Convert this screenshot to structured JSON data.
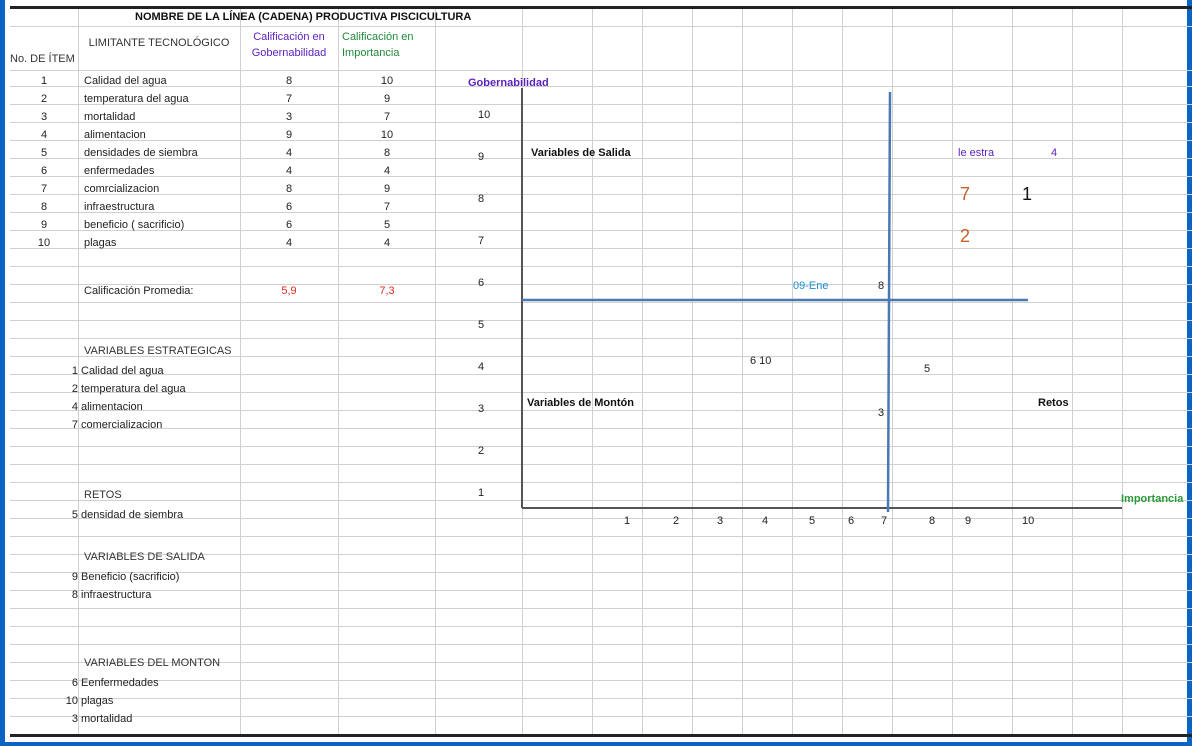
{
  "title": "NOMBRE DE LA LÍNEA (CADENA) PRODUCTIVA   PISCICULTURA",
  "headers": {
    "item": "No. DE ÍTEM",
    "limitante": "LIMITANTE TECNOLÓGICO",
    "gob1": "Calificación en",
    "gob2": "Gobernabilidad",
    "imp1": "Calificación en",
    "imp2": "Importancia"
  },
  "rows": [
    {
      "n": "1",
      "name": "Calidad del agua",
      "gob": "8",
      "imp": "10"
    },
    {
      "n": "2",
      "name": "temperatura del agua",
      "gob": "7",
      "imp": "9"
    },
    {
      "n": "3",
      "name": "mortalidad",
      "gob": "3",
      "imp": "7"
    },
    {
      "n": "4",
      "name": "alimentacion",
      "gob": "9",
      "imp": "10"
    },
    {
      "n": "5",
      "name": "densidades  de  siembra",
      "gob": "4",
      "imp": "8"
    },
    {
      "n": "6",
      "name": "enfermedades",
      "gob": "4",
      "imp": "4"
    },
    {
      "n": "7",
      "name": "comrcializacion",
      "gob": "8",
      "imp": "9"
    },
    {
      "n": "8",
      "name": "infraestructura",
      "gob": "6",
      "imp": "7"
    },
    {
      "n": "9",
      "name": "beneficio  ( sacrificio)",
      "gob": "6",
      "imp": "5"
    },
    {
      "n": "10",
      "name": "plagas",
      "gob": "4",
      "imp": "4"
    }
  ],
  "promedio": {
    "label": "Calificación Promedia:",
    "gob": "5,9",
    "imp": "7,3"
  },
  "sections": [
    {
      "title": "VARIABLES  ESTRATEGICAS",
      "items": [
        {
          "n": "1",
          "name": "Calidad del  agua"
        },
        {
          "n": "2",
          "name": "temperatura del agua"
        },
        {
          "n": "4",
          "name": "alimentacion"
        },
        {
          "n": "7",
          "name": "comercializacion"
        }
      ]
    },
    {
      "title": "RETOS",
      "items": [
        {
          "n": "5",
          "name": "densidad de siembra"
        }
      ]
    },
    {
      "title": "VARIABLES  DE SALIDA",
      "items": [
        {
          "n": "9",
          "name": "Beneficio (sacrificio)"
        },
        {
          "n": "8",
          "name": "infraestructura"
        }
      ]
    },
    {
      "title": "VARIABLES  DEL MONTON",
      "items": [
        {
          "n": "6",
          "name": "Eenfermedades"
        },
        {
          "n": "10",
          "name": "plagas"
        },
        {
          "n": "3",
          "name": "mortalidad"
        }
      ]
    }
  ],
  "chart": {
    "ylabel": "Gobernabilidad",
    "xlabel": "Importancia",
    "yticks": [
      "10",
      "9",
      "8",
      "7",
      "6",
      "5",
      "4",
      "3",
      "2",
      "1"
    ],
    "xticks": [
      "1",
      "2",
      "3",
      "4",
      "5",
      "6",
      "7",
      "8",
      "9",
      "10"
    ],
    "q_salida": "Variables de Salida",
    "q_monton": "Variables de Montón",
    "q_retos": "Retos",
    "q_estra": "le estra",
    "q_estra_n": "4",
    "lbl_09": "09-Ene",
    "lbl_8": "8",
    "lbl_7": "7",
    "lbl_1": "1",
    "lbl_2": "2",
    "lbl_610": "6  10",
    "lbl_5": "5",
    "lbl_3": "3",
    "colors": {
      "axis": "#555555",
      "divider": "#4a78b5",
      "accent": "#0b63c3"
    }
  },
  "chart_data": {
    "type": "scatter",
    "xlabel": "Importancia",
    "ylabel": "Gobernabilidad",
    "xlim": [
      0,
      10
    ],
    "ylim": [
      0,
      10
    ],
    "points": [
      {
        "label": "1",
        "x": 10,
        "y": 8
      },
      {
        "label": "2",
        "x": 9,
        "y": 7
      },
      {
        "label": "3",
        "x": 7,
        "y": 3
      },
      {
        "label": "4",
        "x": 10,
        "y": 9
      },
      {
        "label": "5",
        "x": 8,
        "y": 4
      },
      {
        "label": "6",
        "x": 4,
        "y": 4
      },
      {
        "label": "7",
        "x": 9,
        "y": 8
      },
      {
        "label": "8",
        "x": 7,
        "y": 6
      },
      {
        "label": "9",
        "x": 5,
        "y": 6
      },
      {
        "label": "10",
        "x": 4,
        "y": 4
      }
    ],
    "thresholds": {
      "x": 7.3,
      "y": 5.9
    }
  }
}
